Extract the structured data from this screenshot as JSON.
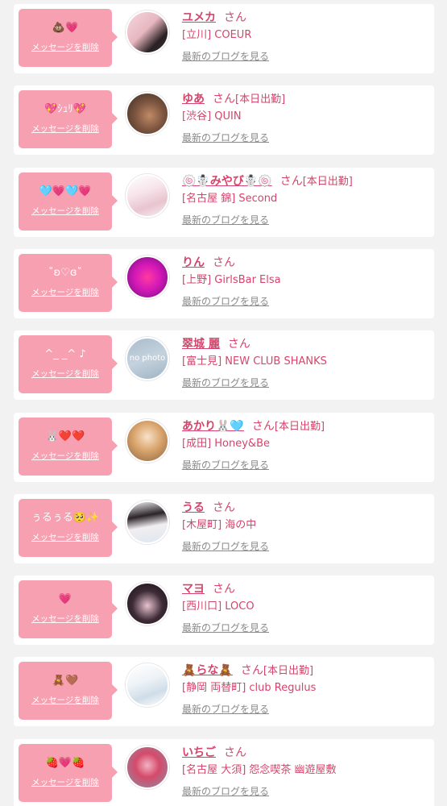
{
  "delete_label": "メッセージを削除",
  "san_label": "さん",
  "blog_label": "最新のブログを見る",
  "colors": {
    "page_bg": "#f2f2f2",
    "bubble": "#f7a0b1",
    "accent": "#d5446c",
    "blog_link": "#8a8a8a"
  },
  "entries": [
    {
      "message": "💩💗",
      "name": "ユメカ",
      "shift": "",
      "shop": "[立川] COEUR",
      "avatar": {
        "photo": true,
        "bg": "linear-gradient(135deg,#f4d6dc 0%,#e8b7c0 45%,#2a2224 75%,#3a2a2e 100%)"
      }
    },
    {
      "message": "💖ｼｭﾘ💖",
      "name": "ゆあ",
      "shift": "[本日出勤]",
      "shop": "[渋谷] QUIN",
      "avatar": {
        "photo": true,
        "bg": "radial-gradient(circle at 55% 55%,#c08a66 0%,#7d5640 45%,#3b2a22 100%)"
      }
    },
    {
      "message": "🩵💗🩵💗",
      "name": "🍥☃️みやび☃️🍥",
      "shift": "[本日出勤]",
      "shop": "[名古屋 錦] Second",
      "avatar": {
        "photo": true,
        "bg": "linear-gradient(160deg,#ffffff 0%,#f7e4ea 40%,#e8c4cf 70%,#f6f0f2 100%)"
      }
    },
    {
      "message": "˚ʚ♡ɞ˚",
      "name": "りん",
      "shift": "",
      "shop": "[上野] GirlsBar Elsa",
      "avatar": {
        "photo": true,
        "bg": "radial-gradient(circle at 50% 50%,#ff3aa0 0%,#d418b8 45%,#6d0f7a 100%)"
      }
    },
    {
      "message": "^_ _^ ♪",
      "name": "翠城 麗",
      "shift": "",
      "shop": "[富士見] NEW CLUB SHANKS",
      "avatar": {
        "photo": false,
        "bg": "linear-gradient(160deg,#a9bccb 0%,#c4d2de 50%,#9fb3c3 100%)",
        "label": "no photo"
      }
    },
    {
      "message": "🐰❤️❤️",
      "name": "あかり🐰🩵",
      "shift": "[本日出勤]",
      "shop": "[成田] Honey&Be",
      "avatar": {
        "photo": true,
        "bg": "radial-gradient(circle at 50% 40%,#f8e2c8 0%,#d9a46c 45%,#8c6441 100%)"
      }
    },
    {
      "message": "ぅるぅる🥺✨",
      "name": "うる",
      "shift": "",
      "shop": "[木屋町] 海の中",
      "avatar": {
        "photo": true,
        "bg": "linear-gradient(170deg,#f4f4f6 0%,#2b2327 35%,#f1eef0 60%,#dde7f0 100%)"
      }
    },
    {
      "message": "💗",
      "name": "マヨ",
      "shift": "",
      "shop": "[西川口] LOCO",
      "avatar": {
        "photo": true,
        "bg": "radial-gradient(circle at 50% 55%,#e8c2cf 0%,#3d2b35 50%,#181216 100%)"
      }
    },
    {
      "message": "🧸🤎",
      "name": "🧸らな🧸",
      "shift": "[本日出勤]",
      "shop": "[静岡 両替町] club Regulus",
      "avatar": {
        "photo": true,
        "bg": "linear-gradient(160deg,#ffffff 0%,#eef3f7 40%,#cfdde8 70%,#ffffff 100%)"
      }
    },
    {
      "message": "🍓💗🍓",
      "name": "いちご",
      "shift": "",
      "shop": "[名古屋 大須] 怨念喫茶 幽遊屋敷",
      "avatar": {
        "photo": true,
        "bg": "radial-gradient(circle at 50% 45%,#f1b3c4 0%,#d54a6a 40%,#8a8fa6 100%)"
      }
    }
  ]
}
